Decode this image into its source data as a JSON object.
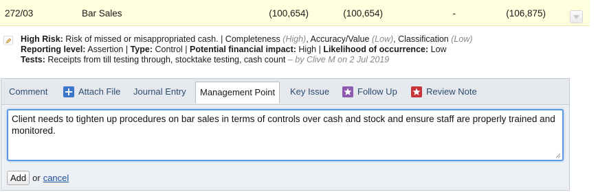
{
  "account_row": {
    "code": "272/03",
    "name": "Bar Sales",
    "values": [
      "(100,654)",
      "(100,654)",
      "-",
      "(106,875)"
    ]
  },
  "risk": {
    "line1": {
      "label": "High Risk:",
      "text": "Risk of missed or misappropriated cash. | Completeness",
      "completeness_level": "(High)",
      "accuracy_label": ", Accuracy/Value",
      "accuracy_level": "(Low)",
      "classification_label": ", Classification",
      "classification_level": "(Low)"
    },
    "line2": {
      "reporting_label": "Reporting level:",
      "reporting_value": "Assertion",
      "sep1": "|",
      "type_label": "Type:",
      "type_value": "Control",
      "sep2": "|",
      "impact_label": "Potential financial impact:",
      "impact_value": "High",
      "sep3": "|",
      "likelihood_label": "Likelihood of occurrence:",
      "likelihood_value": "Low"
    },
    "line3": {
      "tests_label": "Tests:",
      "tests_value": "Receipts from till testing through, stocktake testing, cash count",
      "byline": "– by Clive M on 2 Jul 2019"
    }
  },
  "tabs": {
    "comment": "Comment",
    "attach_file": "Attach File",
    "journal_entry": "Journal Entry",
    "management_point": "Management Point",
    "key_issue": "Key Issue",
    "follow_up": "Follow Up",
    "review_note": "Review Note",
    "active": "Management Point"
  },
  "editor": {
    "value": "Client needs to tighten up procedures on bar sales in terms of controls over cash and stock and ensure staff are properly trained and monitored."
  },
  "actions": {
    "add_label": "Add",
    "or_text": "or",
    "cancel_label": "cancel"
  },
  "colors": {
    "row_highlight": "#ffffdd",
    "focus_border": "#5a98e6",
    "attach_icon": "#3a77c8",
    "follow_icon": "#8e5ab0",
    "review_icon": "#c8333a"
  }
}
